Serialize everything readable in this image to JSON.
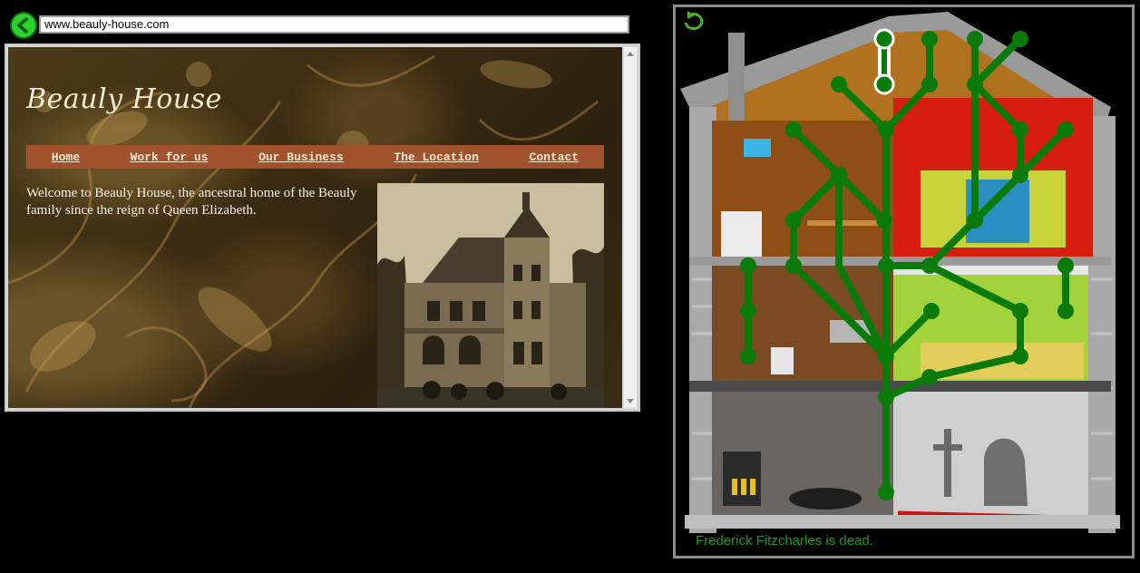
{
  "browser": {
    "url": "www.beauly-house.com"
  },
  "site": {
    "title": "Beauly House",
    "nav": [
      "Home",
      "Work for us",
      "Our Business",
      "The Location",
      "Contact"
    ],
    "welcome": "Welcome to Beauly House, the ancestral home of the Beauly family since the reign of Queen Elizabeth."
  },
  "game": {
    "status": "Frederick Fitzcharles is dead."
  },
  "colors": {
    "nav_bg": "#a0522d",
    "tree_green": "#0a7a0a",
    "back_button": "#2dd12d"
  },
  "icons": {
    "back": "left-arrow-icon",
    "restart": "restart-arrow-icon"
  }
}
